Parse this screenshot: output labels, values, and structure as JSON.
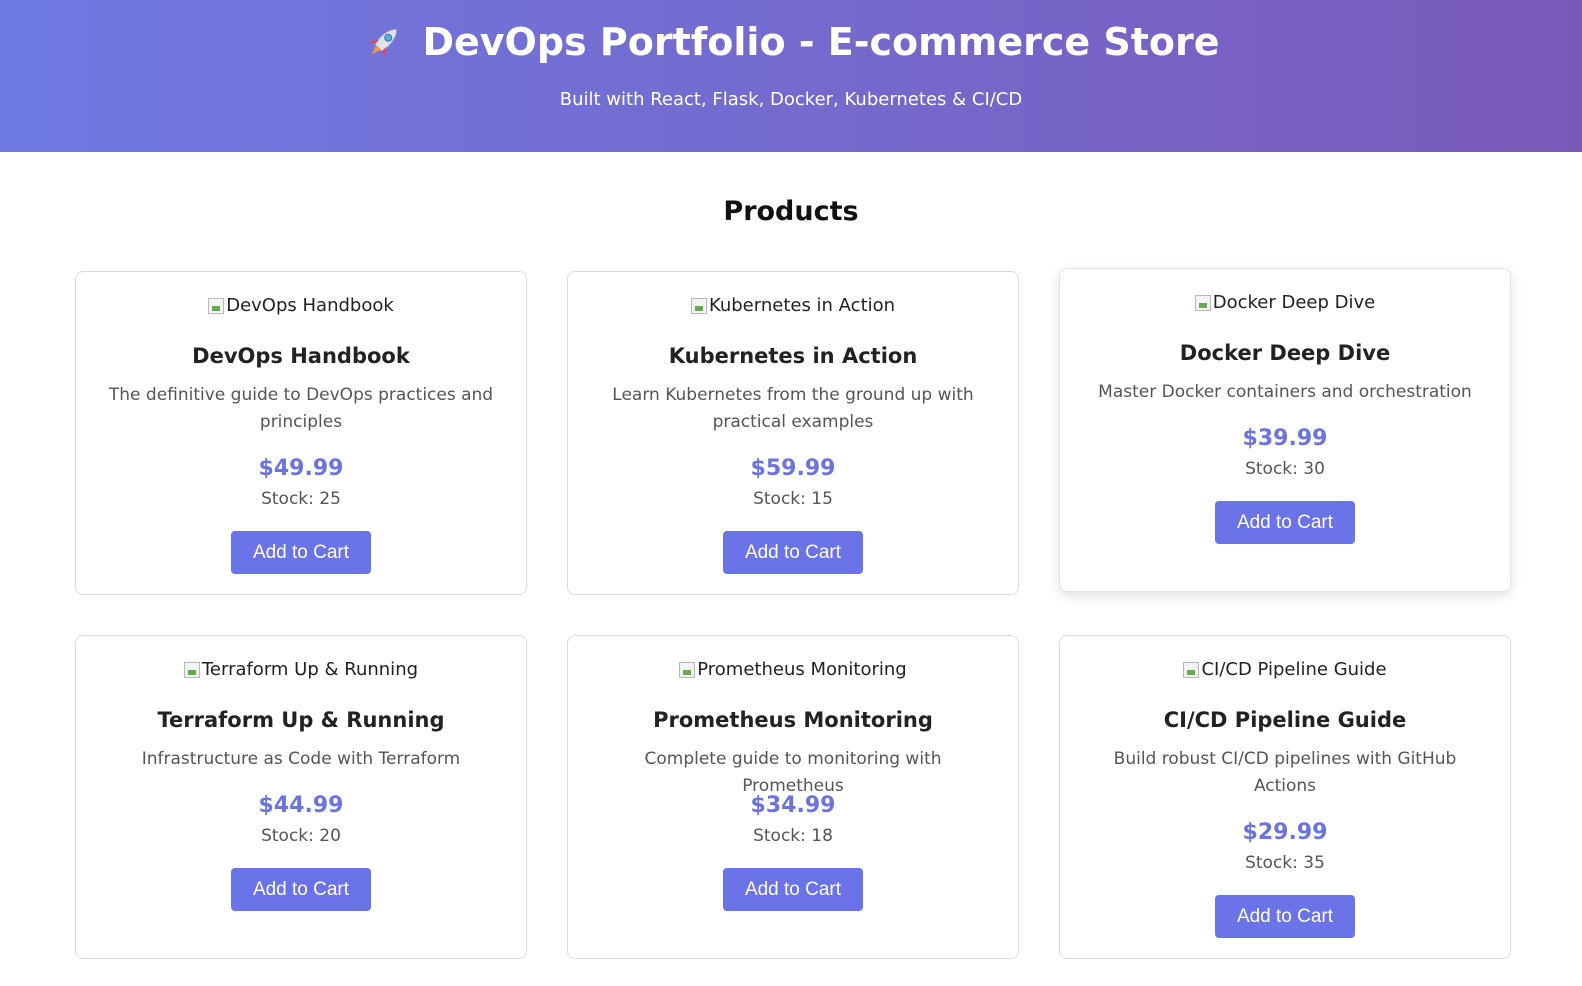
{
  "header": {
    "icon": "rocket-icon",
    "title": "DevOps Portfolio - E-commerce Store",
    "subtitle": "Built with React, Flask, Docker, Kubernetes & CI/CD",
    "gradient_start": "#6f7ae3",
    "gradient_end": "#7a5ab9"
  },
  "main": {
    "section_title": "Products",
    "accent_color": "#6b73e8",
    "products": [
      {
        "image_alt": "DevOps Handbook",
        "name": "DevOps Handbook",
        "description": "The definitive guide to DevOps practices and principles",
        "price": "$49.99",
        "stock": "Stock: 25",
        "button": "Add to Cart"
      },
      {
        "image_alt": "Kubernetes in Action",
        "name": "Kubernetes in Action",
        "description": "Learn Kubernetes from the ground up with practical examples",
        "price": "$59.99",
        "stock": "Stock: 15",
        "button": "Add to Cart"
      },
      {
        "image_alt": "Docker Deep Dive",
        "name": "Docker Deep Dive",
        "description": "Master Docker containers and orchestration",
        "price": "$39.99",
        "stock": "Stock: 30",
        "button": "Add to Cart"
      },
      {
        "image_alt": "Terraform Up & Running",
        "name": "Terraform Up & Running",
        "description": "Infrastructure as Code with Terraform",
        "price": "$44.99",
        "stock": "Stock: 20",
        "button": "Add to Cart"
      },
      {
        "image_alt": "Prometheus Monitoring",
        "name": "Prometheus Monitoring",
        "description": "Complete guide to monitoring with Prometheus",
        "price": "$34.99",
        "stock": "Stock: 18",
        "button": "Add to Cart"
      },
      {
        "image_alt": "CI/CD Pipeline Guide",
        "name": "CI/CD Pipeline Guide",
        "description": "Build robust CI/CD pipelines with GitHub Actions",
        "price": "$29.99",
        "stock": "Stock: 35",
        "button": "Add to Cart"
      }
    ]
  }
}
